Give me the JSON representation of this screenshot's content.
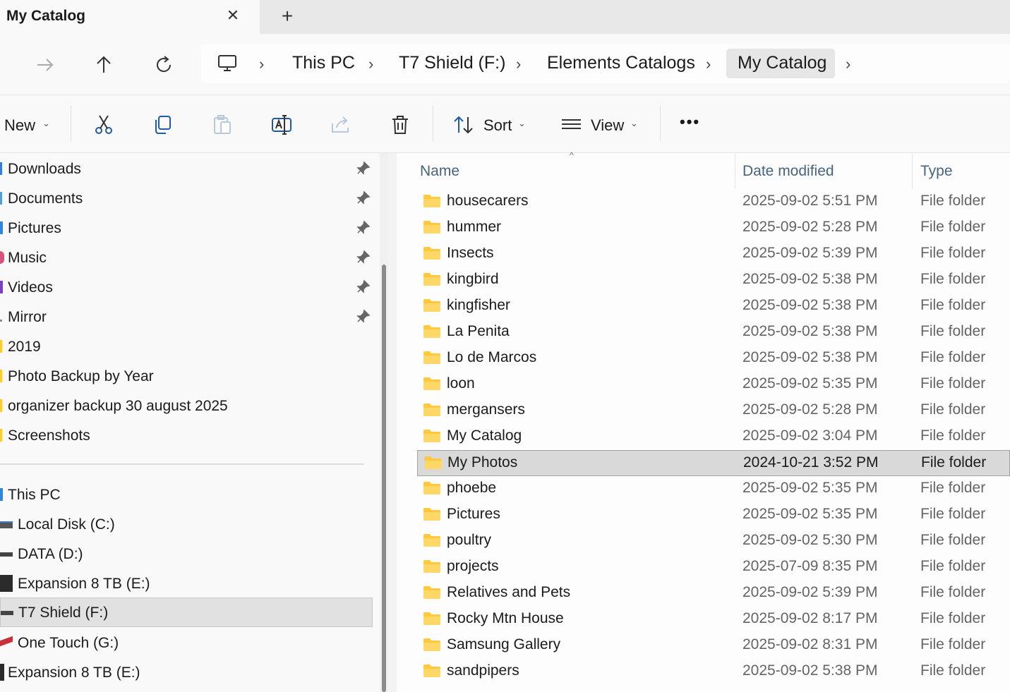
{
  "tab": {
    "title": "My Catalog",
    "close": "✕",
    "new_tab": "+"
  },
  "breadcrumb": [
    "This PC",
    "T7 Shield (F:)",
    "Elements Catalogs",
    "My Catalog"
  ],
  "toolbar": {
    "new_label": "New",
    "sort_label": "Sort",
    "view_label": "View",
    "more": "•••"
  },
  "sidebar": {
    "quick_access": [
      {
        "label": "Downloads",
        "pinned": true
      },
      {
        "label": "Documents",
        "pinned": true
      },
      {
        "label": "Pictures",
        "pinned": true
      },
      {
        "label": "Music",
        "pinned": true
      },
      {
        "label": "Videos",
        "pinned": true
      },
      {
        "label": "Mirror",
        "pinned": true
      },
      {
        "label": "2019",
        "pinned": false
      },
      {
        "label": "Photo Backup by Year",
        "pinned": false
      },
      {
        "label": "organizer backup 30 august 2025",
        "pinned": false
      },
      {
        "label": "Screenshots",
        "pinned": false
      }
    ],
    "this_pc_label": "This PC",
    "drives": [
      {
        "label": "Local Disk (C:)"
      },
      {
        "label": "DATA (D:)"
      },
      {
        "label": "Expansion 8 TB (E:)"
      },
      {
        "label": "T7 Shield (F:)",
        "selected": true
      },
      {
        "label": "One Touch (G:)"
      },
      {
        "label": "Expansion 8 TB (E:)"
      }
    ]
  },
  "columns": {
    "name": "Name",
    "date": "Date modified",
    "type": "Type"
  },
  "files": [
    {
      "name": "housecarers",
      "date": "2025-09-02 5:51 PM",
      "type": "File folder"
    },
    {
      "name": "hummer",
      "date": "2025-09-02 5:28 PM",
      "type": "File folder"
    },
    {
      "name": "Insects",
      "date": "2025-09-02 5:39 PM",
      "type": "File folder"
    },
    {
      "name": "kingbird",
      "date": "2025-09-02 5:38 PM",
      "type": "File folder"
    },
    {
      "name": "kingfisher",
      "date": "2025-09-02 5:38 PM",
      "type": "File folder"
    },
    {
      "name": "La Penita",
      "date": "2025-09-02 5:38 PM",
      "type": "File folder"
    },
    {
      "name": "Lo de Marcos",
      "date": "2025-09-02 5:38 PM",
      "type": "File folder"
    },
    {
      "name": "loon",
      "date": "2025-09-02 5:35 PM",
      "type": "File folder"
    },
    {
      "name": "mergansers",
      "date": "2025-09-02 5:28 PM",
      "type": "File folder"
    },
    {
      "name": "My Catalog",
      "date": "2025-09-02 3:04 PM",
      "type": "File folder"
    },
    {
      "name": "My Photos",
      "date": "2024-10-21 3:52 PM",
      "type": "File folder",
      "selected": true
    },
    {
      "name": "phoebe",
      "date": "2025-09-02 5:35 PM",
      "type": "File folder"
    },
    {
      "name": "Pictures",
      "date": "2025-09-02 5:35 PM",
      "type": "File folder"
    },
    {
      "name": "poultry",
      "date": "2025-09-02 5:30 PM",
      "type": "File folder"
    },
    {
      "name": "projects",
      "date": "2025-07-09 8:35 PM",
      "type": "File folder"
    },
    {
      "name": "Relatives and Pets",
      "date": "2025-09-02 5:39 PM",
      "type": "File folder"
    },
    {
      "name": "Rocky Mtn House",
      "date": "2025-09-02 8:17 PM",
      "type": "File folder"
    },
    {
      "name": "Samsung Gallery",
      "date": "2025-09-02 8:31 PM",
      "type": "File folder"
    },
    {
      "name": "sandpipers",
      "date": "2025-09-02 5:38 PM",
      "type": "File folder"
    }
  ],
  "colors": {
    "folder": "#ffc83d",
    "selection": "#d9d9d9",
    "header_text": "#46647d"
  }
}
